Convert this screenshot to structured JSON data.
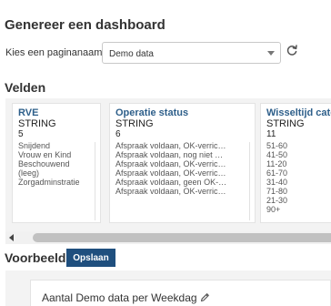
{
  "header": {
    "title": "Genereer een dashboard"
  },
  "page_select": {
    "label": "Kies een paginanaam",
    "value": "Demo data"
  },
  "fields": {
    "title": "Velden",
    "cards": [
      {
        "name": "RVE",
        "type": "STRING",
        "count": "5",
        "values": [
          "Snijdend",
          "Vrouw en Kind",
          "Beschouwend",
          "(leeg)",
          "Zorgadminstratie"
        ]
      },
      {
        "name": "Operatie status",
        "type": "STRING",
        "count": "6",
        "values": [
          "Afspraak voldaan, OK-verric…",
          "Afspraak voldaan, nog niet …",
          "Afspraak voldaan, OK-verric…",
          "Afspraak voldaan, OK-verric…",
          "Afspraak voldaan, geen OK-…",
          "Afspraak voldaan, OK-verric…"
        ]
      },
      {
        "name": "Wisseltijd categorie",
        "type": "STRING",
        "count": "11",
        "values": [
          "51-60",
          "41-50",
          "11-20",
          "61-70",
          "31-40",
          "71-80",
          "21-30",
          "90+"
        ]
      }
    ]
  },
  "preview": {
    "title": "Voorbeeld",
    "save_label": "Opslaan",
    "chart_title": "Aantal Demo data per Weekdag"
  },
  "colors": {
    "accent": "#1f4f7e",
    "field_name": "#2e5f8a"
  }
}
